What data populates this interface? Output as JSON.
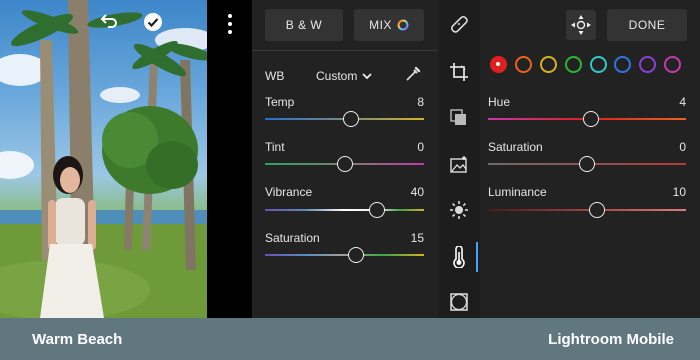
{
  "photo": {
    "undo_icon": "undo-icon",
    "confirm_icon": "checkmark-circle-icon",
    "more_icon": "more-vertical-icon"
  },
  "toolbar": {
    "bw_label": "B & W",
    "mix_label": "MIX",
    "done_label": "DONE"
  },
  "wb": {
    "label": "WB",
    "mode": "Custom",
    "eyedropper_icon": "eyedropper-icon"
  },
  "left_sliders": [
    {
      "label": "Temp",
      "value": "8",
      "position": 0.51
    },
    {
      "label": "Tint",
      "value": "0",
      "position": 0.47
    },
    {
      "label": "Vibrance",
      "value": "40",
      "position": 0.7
    },
    {
      "label": "Saturation",
      "value": "15",
      "position": 0.57
    }
  ],
  "tools": [
    "healing-brush-icon",
    "crop-icon",
    "presets-icon",
    "selective-icon",
    "light-icon",
    "color-thermometer-icon",
    "vignette-icon"
  ],
  "active_tool": "color-thermometer-icon",
  "color_mix": {
    "colors": [
      "#e02020",
      "#e8641e",
      "#d6b21c",
      "#2cb532",
      "#2fc9c9",
      "#2f74e0",
      "#8a3fd6",
      "#c43aa8"
    ],
    "selected_index": 0,
    "target_icon": "target-adjust-icon"
  },
  "right_sliders": [
    {
      "label": "Hue",
      "value": "4",
      "position": 0.52
    },
    {
      "label": "Saturation",
      "value": "0",
      "position": 0.5
    },
    {
      "label": "Luminance",
      "value": "10",
      "position": 0.55
    }
  ],
  "caption": {
    "left": "Warm Beach",
    "right": "Lightroom Mobile"
  }
}
